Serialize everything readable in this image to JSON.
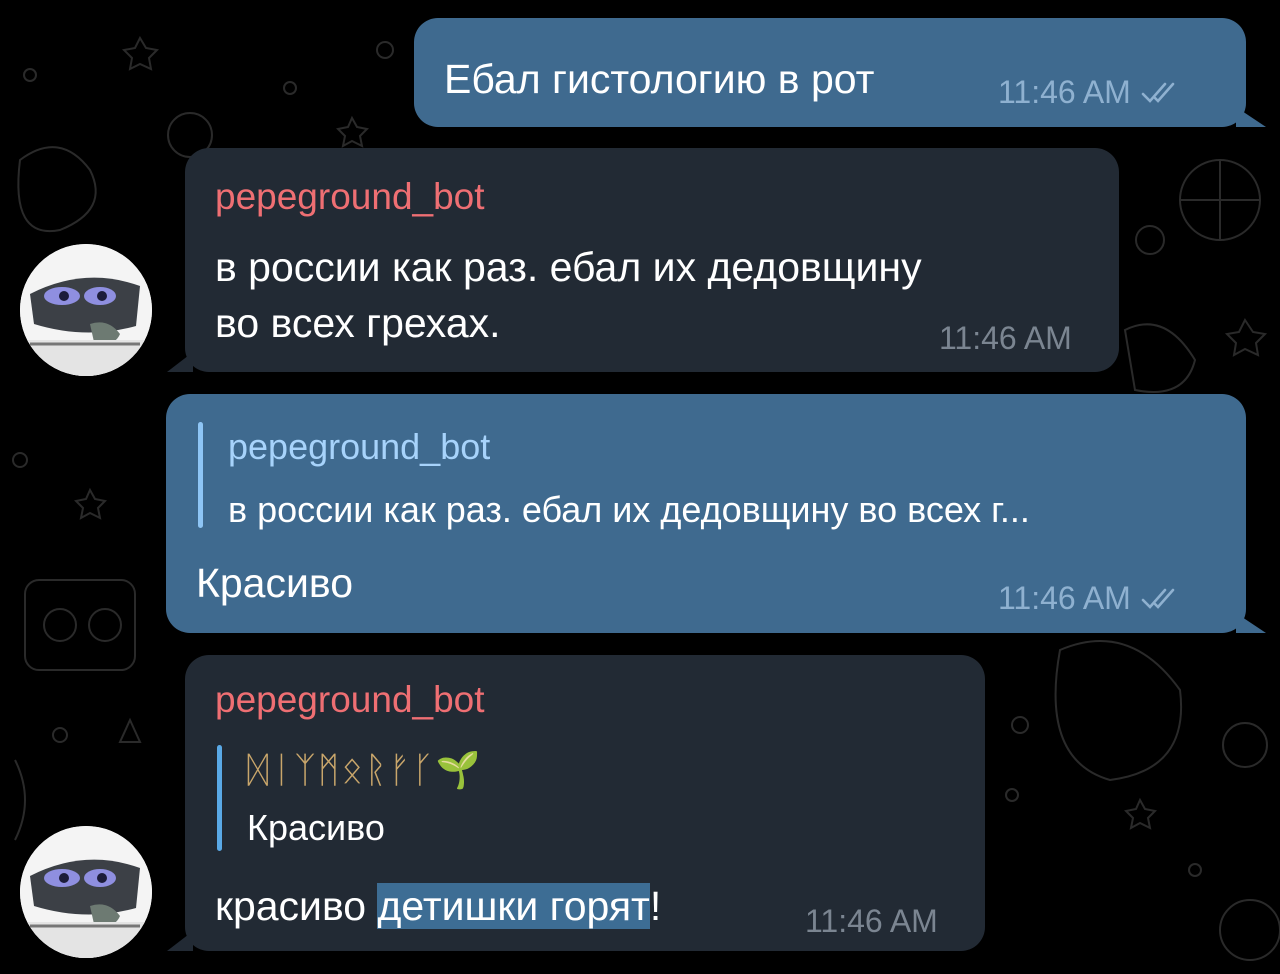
{
  "messages": [
    {
      "direction": "outgoing",
      "text": "Ебал гистологию в рот",
      "time": "11:46 AM",
      "status_icon": "double-check-icon"
    },
    {
      "direction": "incoming",
      "sender": "pepeground_bot",
      "text_line1": "в россии как раз. ебал их дедовщину",
      "text_line2": "во всех грехах.",
      "time": "11:46 AM"
    },
    {
      "direction": "outgoing",
      "reply_to": {
        "name": "pepeground_bot",
        "text": "в россии как раз. ебал их дедовщину во всех г..."
      },
      "text": "Красиво",
      "time": "11:46 AM",
      "status_icon": "double-check-icon"
    },
    {
      "direction": "incoming",
      "sender": "pepeground_bot",
      "reply_to": {
        "name": "ᛞᛁᛉᛗᛟᚱᚠᚴ🌱",
        "text": "Красиво"
      },
      "text_plain": "красиво ",
      "text_selected": "детишки горят",
      "text_after": "!",
      "time": "11:46 AM"
    }
  ],
  "colors": {
    "outgoing_bubble": "#3f6a8f",
    "incoming_bubble": "#222a34",
    "sender_name": "#ef6f73",
    "reply_bar_out": "#8ec5f5",
    "reply_name_out": "#a7d3fb",
    "reply_bar_in": "#5aa9e6",
    "reply_name_in": "#c9a66b"
  }
}
